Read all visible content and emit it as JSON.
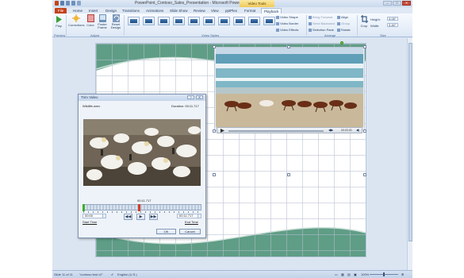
{
  "window": {
    "title": "PowerPoint_Contoso_Sales_Presentation - Microsoft PowerPoint",
    "context_tab": "Video Tools",
    "min": "–",
    "max": "□",
    "close": "✕"
  },
  "tabs": [
    "File",
    "Home",
    "Insert",
    "Design",
    "Transitions",
    "Animations",
    "Slide Show",
    "Review",
    "View",
    "pptPlex",
    "Format",
    "Playback"
  ],
  "ribbon": {
    "groups": {
      "preview": "Preview",
      "adjust": "Adjust",
      "video_styles": "Video Styles",
      "arrange": "Arrange",
      "size": "Size"
    },
    "buttons": {
      "play": "Play",
      "corrections": "Corrections",
      "color": "Color",
      "poster_frame": "Poster Frame",
      "reset_design": "Reset Design",
      "crop": "Crop"
    },
    "video_cmds": [
      "Video Shape",
      "Video Border",
      "Video Effects"
    ],
    "arrange_cmds": [
      "Bring Forward",
      "Send Backward",
      "Selection Pane"
    ],
    "align_cmds": [
      "Align",
      "Group",
      "Rotate"
    ],
    "height_label": "Height:",
    "height_value": "3.08\"",
    "width_label": "Width:",
    "width_value": "3.46\""
  },
  "slide_video": {
    "time": "00:03.00"
  },
  "trim_dialog": {
    "title": "Trim Video",
    "help": "?",
    "close": "✕",
    "file_name": "Wildlife.wmv",
    "duration_label": "Duration:",
    "duration_value": "00:11.717",
    "current_time": "00:11.717",
    "start_value": "00:00",
    "start_label": "Start Time",
    "end_value": "00:11.717",
    "end_label": "End Time",
    "prev_frame": "◀◀",
    "play": "▶",
    "next_frame": "▶▶",
    "ok": "OK",
    "cancel": "Cancel"
  },
  "status": {
    "slide": "Slide 11 of 11",
    "theme": "\"contoso test v2\"",
    "language": "English (U.S.)",
    "zoom": "100%"
  }
}
